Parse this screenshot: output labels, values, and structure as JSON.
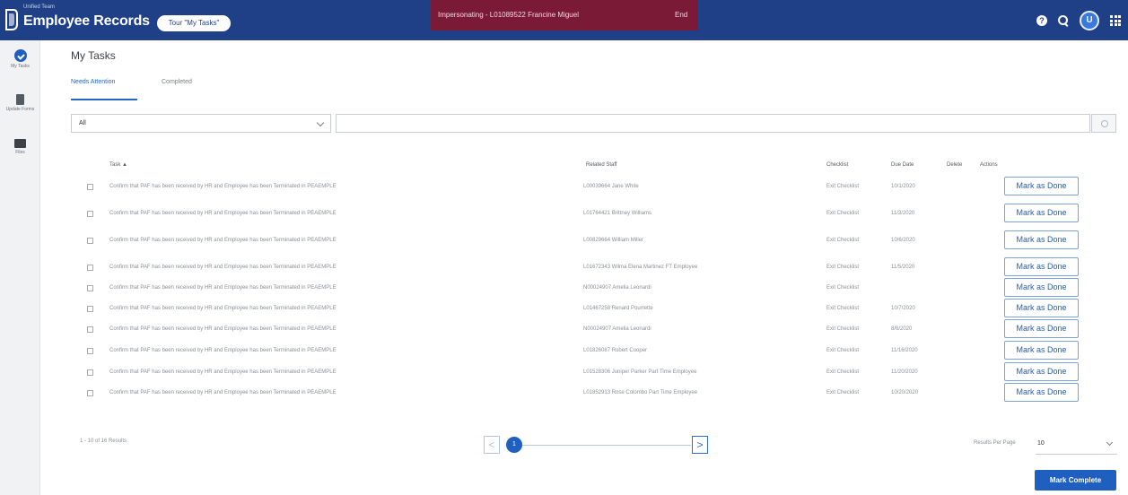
{
  "header": {
    "brand_small": "Unified Team",
    "app_title": "Employee Records",
    "tour_button": "Tour \"My Tasks\"",
    "impersonating_text": "Impersonating - L01089522 Francine Miguel",
    "end_label": "End",
    "help_icon": "help-icon",
    "user_initial": "U",
    "bar_color": "#1f3f86",
    "impersonate_color": "#7a1a37"
  },
  "sidebar": {
    "items": [
      {
        "label": "My Tasks",
        "icon": "tasks-check-icon",
        "active": true
      },
      {
        "label": "Update Forms",
        "icon": "document-icon",
        "active": false
      },
      {
        "label": "Files",
        "icon": "folder-icon",
        "active": false
      }
    ]
  },
  "page": {
    "title": "My Tasks",
    "tabs": [
      {
        "label": "Needs Attention",
        "active": true
      },
      {
        "label": "Completed",
        "active": false
      }
    ],
    "filter": {
      "selected": "All",
      "search_value": ""
    }
  },
  "table": {
    "columns": [
      "Task ▲",
      "Related Staff",
      "Checklist",
      "Due Date",
      "Delete",
      "Actions"
    ],
    "rows": [
      {
        "task": "Confirm that PAF has been received by HR and Employee has been Terminated in PEAEMPLE",
        "staff": "L00039664 Jane White",
        "checklist": "Exit Checklist",
        "due": "10/1/2020",
        "action": "Mark as Done"
      },
      {
        "task": "Confirm that PAF has been received by HR and Employee has been Terminated in PEAEMPLE",
        "staff": "L01764421 Brittney Williams",
        "checklist": "Exit Checklist",
        "due": "11/3/2020",
        "action": "Mark as Done"
      },
      {
        "task": "Confirm that PAF has been received by HR and Employee has been Terminated in PEAEMPLE",
        "staff": "L00829664 William Miller",
        "checklist": "Exit Checklist",
        "due": "10/6/2020",
        "action": "Mark as Done"
      },
      {
        "task": "Confirm that PAF has been received by HR and Employee has been Terminated in PEAEMPLE",
        "staff": "L01672343 Wilma Elena Martinez FT Employee",
        "checklist": "Exit Checklist",
        "due": "11/5/2020",
        "action": "Mark as Done"
      },
      {
        "task": "Confirm that PAF has been received by HR and Employee has been Terminated in PEAEMPLE",
        "staff": "N00024907 Amelia Leonardi",
        "checklist": "Exit Checklist",
        "due": "",
        "action": "Mark as Done"
      },
      {
        "task": "Confirm that PAF has been received by HR and Employee has been Terminated in PEAEMPLE",
        "staff": "L01467258 Renard Pourrette",
        "checklist": "Exit Checklist",
        "due": "10/7/2020",
        "action": "Mark as Done"
      },
      {
        "task": "Confirm that PAF has been received by HR and Employee has been Terminated in PEAEMPLE",
        "staff": "N00024907 Amelia Leonardi",
        "checklist": "Exit Checklist",
        "due": "8/6/2020",
        "action": "Mark as Done"
      },
      {
        "task": "Confirm that PAF has been received by HR and Employee has been Terminated in PEAEMPLE",
        "staff": "L01826087 Robert Cooper",
        "checklist": "Exit Checklist",
        "due": "11/16/2020",
        "action": "Mark as Done"
      },
      {
        "task": "Confirm that PAF has been received by HR and Employee has been Terminated in PEAEMPLE",
        "staff": "L01528306 Juniper Parker Part Time Employee",
        "checklist": "Exit Checklist",
        "due": "11/20/2020",
        "action": "Mark as Done"
      },
      {
        "task": "Confirm that PAF has been received by HR and Employee has been Terminated in PEAEMPLE",
        "staff": "L01852913 Rose Colombo Part Time Employee",
        "checklist": "Exit Checklist",
        "due": "10/20/2020",
        "action": "Mark as Done"
      }
    ]
  },
  "footer": {
    "results": "1 - 10 of 16 Results",
    "current_page": "1",
    "prev_symbol": "<",
    "next_symbol": ">",
    "per_page_label": "Results Per Page",
    "per_page_value": "10",
    "complete_button": "Mark Complete"
  }
}
